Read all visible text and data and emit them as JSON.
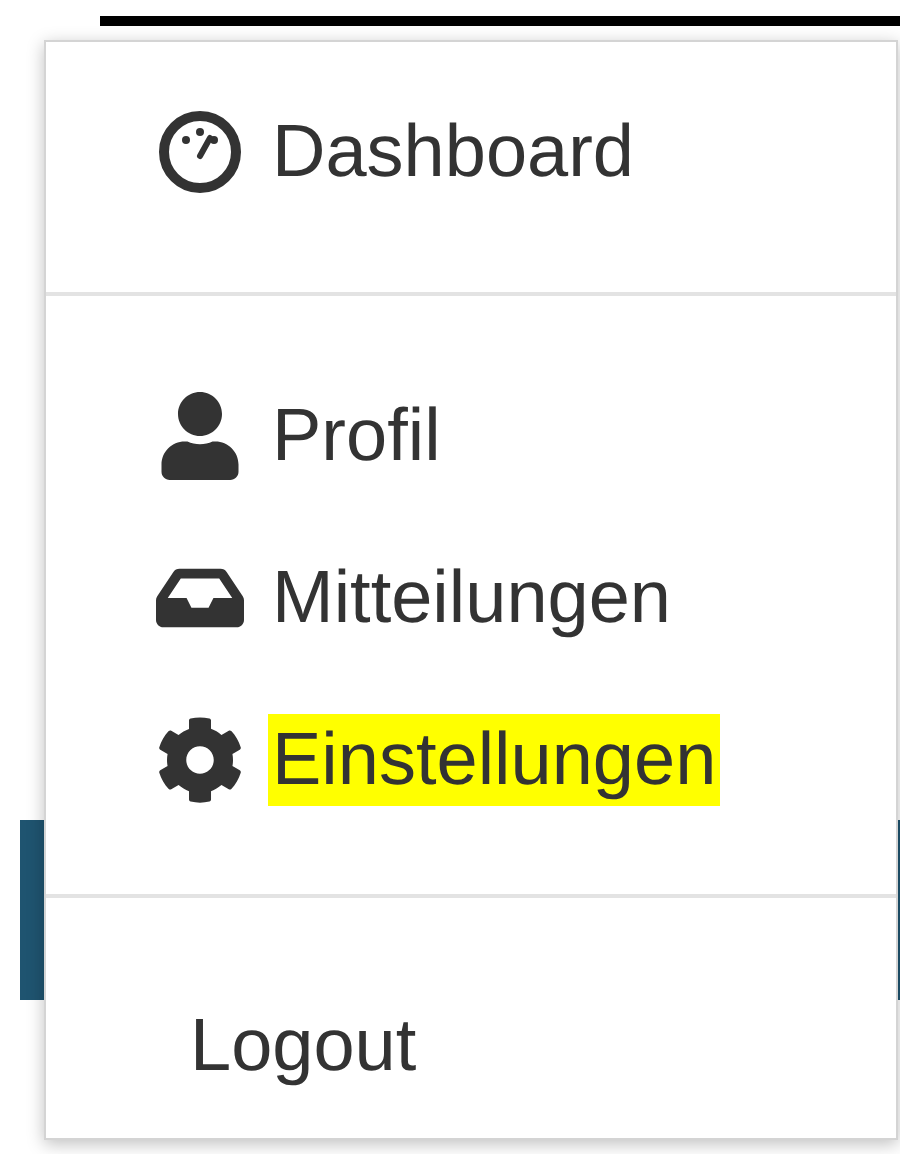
{
  "menu": {
    "groups": [
      {
        "items": [
          {
            "label": "Dashboard",
            "highlighted": false
          }
        ]
      },
      {
        "items": [
          {
            "label": "Profil",
            "highlighted": false
          },
          {
            "label": "Mitteilungen",
            "highlighted": false
          },
          {
            "label": "Einstellungen",
            "highlighted": true
          }
        ]
      },
      {
        "items": [
          {
            "label": "Logout",
            "highlighted": false
          }
        ]
      }
    ]
  }
}
